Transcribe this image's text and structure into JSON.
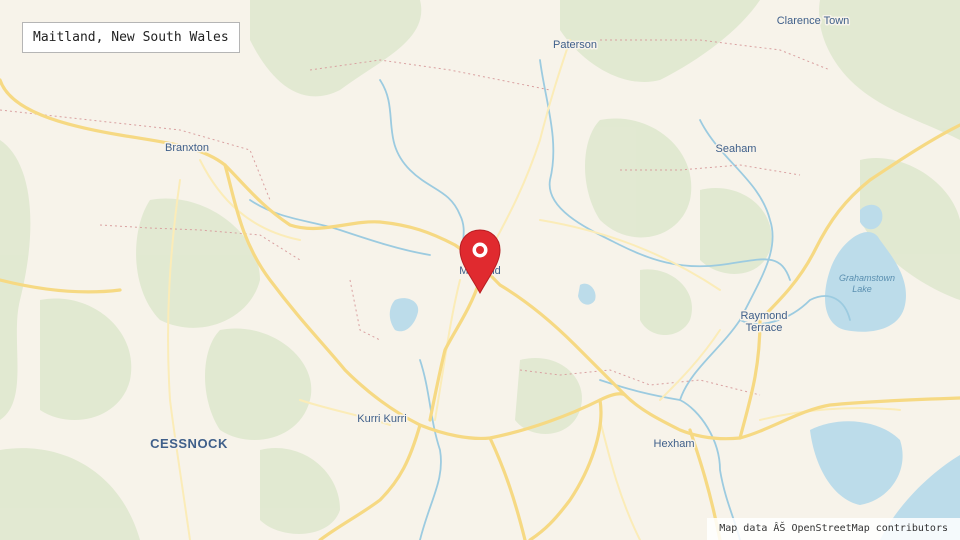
{
  "title": "Maitland, New South Wales",
  "attribution": "Map data ÂŠ OpenStreetMap contributors",
  "colors": {
    "land": "#f7f3ea",
    "vegetation": "#dfe8cf",
    "water": "#bcdcea",
    "river": "#9ccbe0",
    "road_major": "#f6d983",
    "road_minor": "#fbecb8",
    "boundary": "#d9a0a0",
    "label": "#3f5f8a",
    "marker": "#e02a2f"
  },
  "places": {
    "clarence_town": "Clarence Town",
    "paterson": "Paterson",
    "branxton": "Branxton",
    "seaham": "Seaham",
    "maitland": "Maitland",
    "raymond_terrace_1": "Raymond",
    "raymond_terrace_2": "Terrace",
    "kurri_kurri": "Kurri Kurri",
    "cessnock": "CESSNOCK",
    "hexham": "Hexham"
  },
  "water_labels": {
    "grahamstown_1": "Grahamstown",
    "grahamstown_2": "Lake"
  },
  "marker": {
    "icon": "map-pin-icon"
  }
}
